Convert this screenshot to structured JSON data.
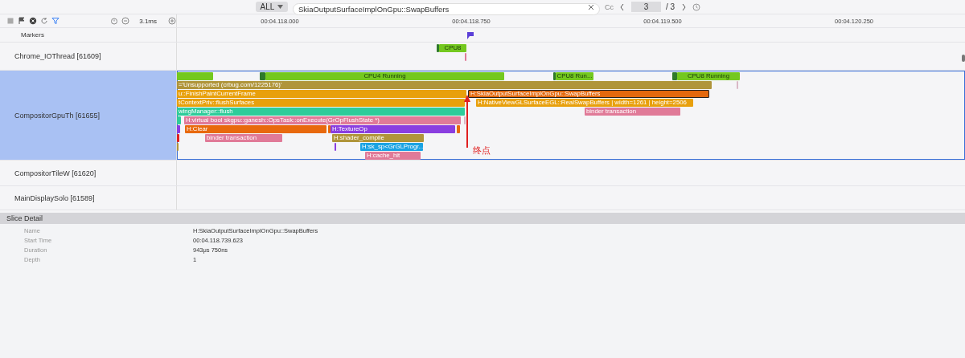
{
  "toolbar": {
    "filter": "ALL",
    "search": "SkiaOutputSurfaceImplOnGpu::SwapBuffers",
    "case_toggle": "Cc",
    "current_match": "3",
    "match_total": "/ 3"
  },
  "timeline": {
    "zoom": "3.1ms",
    "ticks": [
      "00:04.118.000",
      "00:04.118.750",
      "00:04.119.500",
      "00:04.120.250"
    ]
  },
  "markers": {
    "label": "Markers"
  },
  "tracks": [
    {
      "name": "Chrome_IOThread [61609]",
      "selected": false,
      "slices": [
        {
          "color": "#2f7a2b",
          "selected": false
        },
        {
          "label": "CPU8",
          "color": "#74c81f",
          "selected": false
        },
        {
          "color": "#e07a98",
          "selected": false
        }
      ]
    },
    {
      "name": "CompositorGpuTh [61655]",
      "selected": true,
      "slices": [
        {
          "color": "#74c81f",
          "selected": false
        },
        {
          "color": "#2f7a2b",
          "selected": false
        },
        {
          "label": "CPU4 Running",
          "color": "#74c81f",
          "selected": false
        },
        {
          "color": "#2f7a2b",
          "selected": false
        },
        {
          "label": "CPU8 Run...",
          "color": "#74c81f",
          "selected": false
        },
        {
          "color": "#2f7a2b",
          "selected": false
        },
        {
          "label": "CPU8 Running",
          "color": "#74c81f",
          "selected": false
        },
        {
          "label": "='Unsupported (crbug.com/1225176)'",
          "color": "#b0953a",
          "selected": false
        },
        {
          "color": "#d9b8c6",
          "selected": false
        },
        {
          "label": "u::FinishPaintCurrentFrame",
          "color": "#e8a00c",
          "selected": false
        },
        {
          "label": "H:SkiaOutputSurfaceImplOnGpu::SwapBuffers",
          "color": "#e3680d",
          "selected": true
        },
        {
          "label": "tContextPriv::flushSurfaces",
          "color": "#e8a00c",
          "selected": false
        },
        {
          "label": "H:NativeViewGLSurfaceEGL::RealSwapBuffers | width=1261 | height=2506",
          "color": "#e8a00c",
          "selected": false
        },
        {
          "label": "wingManager::flush",
          "color": "#2ecc9a",
          "selected": false
        },
        {
          "label": "binder transaction",
          "color": "#e07a98",
          "selected": false
        },
        {
          "color": "#2ecc9a",
          "selected": false
        },
        {
          "label": "H:virtual bool skgpu::ganesh::OpsTask::onExecute(GrOpFlushState *)",
          "color": "#e07a98",
          "selected": false
        },
        {
          "color": "#d9b8c6",
          "selected": false
        },
        {
          "color": "#8a3ee0",
          "selected": false
        },
        {
          "label": "H:Clear",
          "color": "#e8690d",
          "selected": false
        },
        {
          "color": "#e8690d",
          "selected": false
        },
        {
          "label": "H:TextureOp",
          "color": "#8a3ee0",
          "selected": false
        },
        {
          "color": "#e8690d",
          "selected": false
        },
        {
          "color": "#e02020",
          "selected": false
        },
        {
          "label": "binder transaction",
          "color": "#e07a98",
          "selected": false
        },
        {
          "label": "H:shader_compile",
          "color": "#b0953a",
          "selected": false
        },
        {
          "color": "#b0953a",
          "selected": false
        },
        {
          "color": "#8a3ee0",
          "selected": false
        },
        {
          "label": "H:sk_sp<GrGLProgr...",
          "color": "#1aa3e3",
          "selected": false
        },
        {
          "label": "H:cache_hit",
          "color": "#e07a98",
          "selected": false
        }
      ]
    },
    {
      "name": "CompositorTileW [61620]",
      "selected": false
    },
    {
      "name": "MainDisplaySolo [61589]",
      "selected": false
    }
  ],
  "annotation": {
    "label": "终点"
  },
  "slice_detail": {
    "title": "Slice Detail",
    "fields": [
      {
        "label": "Name",
        "value": "H:SkiaOutputSurfaceImplOnGpu::SwapBuffers"
      },
      {
        "label": "Start Time",
        "value": "00:04.118.739.623"
      },
      {
        "label": "Duration",
        "value": "943μs 750ns"
      },
      {
        "label": "Depth",
        "value": "1"
      }
    ]
  }
}
